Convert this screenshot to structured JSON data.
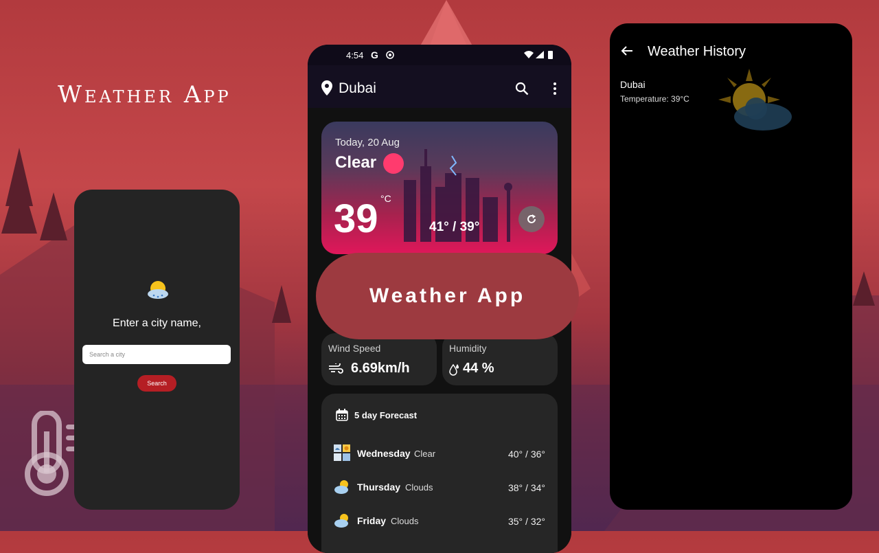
{
  "promo": {
    "title": "Weather App",
    "badge": "Weather App"
  },
  "search_screen": {
    "heading": "Enter a city name,",
    "input_placeholder": "Search a city",
    "button_label": "Search"
  },
  "main_screen": {
    "status": {
      "time": "4:54",
      "g_label": "G"
    },
    "appbar": {
      "city": "Dubai"
    },
    "hero": {
      "date": "Today, 20 Aug",
      "condition": "Clear",
      "temperature": "39",
      "unit": "°C",
      "range": "41° / 39°"
    },
    "wind": {
      "label": "Wind Speed",
      "value": "6.69km/h"
    },
    "humidity": {
      "label": "Humidity",
      "value": "44 %"
    },
    "forecast": {
      "title": "5 day Forecast",
      "days": [
        {
          "day": "Wednesday",
          "condition": "Clear",
          "temps": "40° / 36°",
          "icon": "weather-grid-icon"
        },
        {
          "day": "Thursday",
          "condition": "Clouds",
          "temps": "38° / 34°",
          "icon": "sun-cloud-icon"
        },
        {
          "day": "Friday",
          "condition": "Clouds",
          "temps": "35° / 32°",
          "icon": "sun-cloud-icon"
        }
      ]
    }
  },
  "history_screen": {
    "title": "Weather History",
    "entry_city": "Dubai",
    "entry_temperature": "Temperature: 39°C"
  },
  "colors": {
    "accent_red": "#b51e24",
    "pill": "#9d3a40",
    "card": "#262626",
    "background_red": "#c4474a"
  }
}
